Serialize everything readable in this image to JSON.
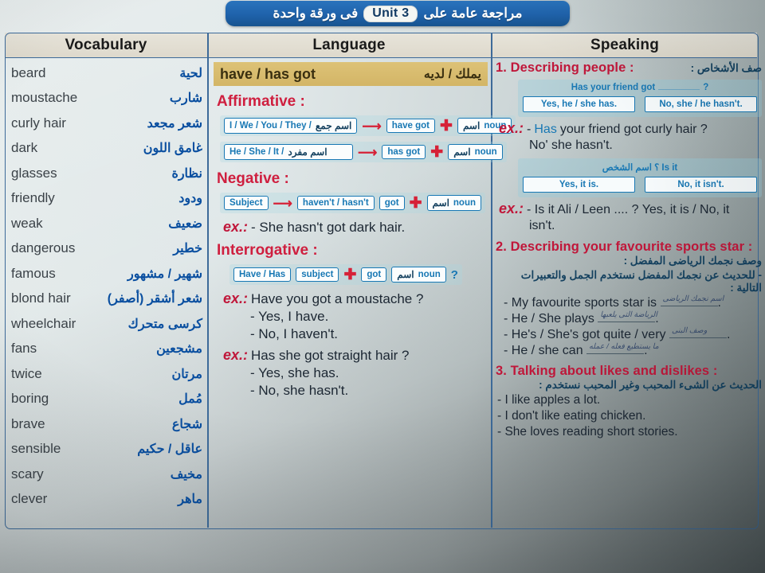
{
  "banner": {
    "text_right": "مراجعة عامة على",
    "unit": "Unit 3",
    "text_left": "فى ورقة واحدة"
  },
  "headers": {
    "vocabulary": "Vocabulary",
    "language": "Language",
    "speaking": "Speaking"
  },
  "vocabulary": [
    {
      "en": "beard",
      "ar": "لحية"
    },
    {
      "en": "moustache",
      "ar": "شارب"
    },
    {
      "en": "curly hair",
      "ar": "شعر مجعد"
    },
    {
      "en": "dark",
      "ar": "غامق اللون"
    },
    {
      "en": "glasses",
      "ar": "نظارة"
    },
    {
      "en": "friendly",
      "ar": "ودود"
    },
    {
      "en": "weak",
      "ar": "ضعيف"
    },
    {
      "en": "dangerous",
      "ar": "خطير"
    },
    {
      "en": "famous",
      "ar": "شهير / مشهور"
    },
    {
      "en": "blond hair",
      "ar": "شعر أشقر (أصفر)"
    },
    {
      "en": "wheelchair",
      "ar": "كرسى متحرك"
    },
    {
      "en": "fans",
      "ar": "مشجعين"
    },
    {
      "en": "twice",
      "ar": "مرتان"
    },
    {
      "en": "boring",
      "ar": "مُمل"
    },
    {
      "en": "brave",
      "ar": "شجاع"
    },
    {
      "en": "sensible",
      "ar": "عاقل / حكيم"
    },
    {
      "en": "scary",
      "ar": "مخيف"
    },
    {
      "en": "clever",
      "ar": "ماهر"
    }
  ],
  "language": {
    "title_en": "have / has got",
    "title_ar": "يملك / لديه",
    "affirmative": {
      "heading": "Affirmative :",
      "row1": {
        "subject_en": "I / We / You / They /",
        "subject_ar": "اسم جمع",
        "verb": "have got",
        "noun_ar": "اسم",
        "noun_en": "noun"
      },
      "row2": {
        "subject_en": "He / She / It /",
        "subject_ar": "اسم مفرد",
        "verb": "has got",
        "noun_ar": "اسم",
        "noun_en": "noun"
      }
    },
    "negative": {
      "heading": "Negative :",
      "subject": "Subject",
      "aux": "haven't / hasn't",
      "got": "got",
      "noun_ar": "اسم",
      "noun_en": "noun",
      "ex_label": "ex.:",
      "ex": "- She hasn't got dark hair."
    },
    "interrogative": {
      "heading": "Interrogative :",
      "aux": "Have / Has",
      "subject": "subject",
      "got": "got",
      "noun_ar": "اسم",
      "noun_en": "noun",
      "question_mark": "?",
      "ex1_label": "ex.:",
      "ex1": "Have you got a moustache ?",
      "ex1_a1": "- Yes, I have.",
      "ex1_a2": "- No, I haven't.",
      "ex2_label": "ex.:",
      "ex2": "Has she got straight hair ?",
      "ex2_a1": "- Yes, she has.",
      "ex2_a2": "- No, she hasn't."
    }
  },
  "speaking": {
    "section1": {
      "number_title": "1. Describing people :",
      "arabic": "صف الأشخاص :",
      "dialogue1": {
        "question_pre": "Has your friend got",
        "question_post": "?",
        "answer_yes": "Yes, he / she has.",
        "answer_no": "No, she / he hasn't."
      },
      "ex_label": "ex.:",
      "ex_dash": "-",
      "ex_highlight": "Has",
      "ex_rest": "your friend got curly hair ?",
      "ex_line2_pre": "No' she ",
      "ex_line2_highlight": "hasn't.",
      "dialogue2": {
        "question_en": "Is it",
        "question_ar": "اسم الشخص",
        "question_post": "؟",
        "answer_yes": "Yes, it is.",
        "answer_no": "No, it isn't."
      },
      "ex2_label": "ex.:",
      "ex2": "- Is it Ali / Leen .... ? Yes, it is / No, it",
      "ex2_line2": "isn't."
    },
    "section2": {
      "number_title": "2. Describing your favourite sports star :",
      "arabic_title": "وصف نجمك الرياضى المفضل :",
      "arabic_note": "- للحديث عن نجمك المفضل نستخدم الجمل والتعبيرات التالية :",
      "bullets": [
        {
          "text": "- My favourite sports star is",
          "hand": "اسم نجمك الرياضى"
        },
        {
          "text": "- He / She plays",
          "hand": "الرياضة التى يلعبها"
        },
        {
          "text": "- He's / She's got quite / very",
          "hand": "وصف البنى"
        },
        {
          "text": "- He / she can",
          "hand": "ما يستطيع فعله / عمله"
        }
      ]
    },
    "section3": {
      "number_title": "3. Talking about likes and dislikes :",
      "arabic": "الحديث عن الشىء المحبب وغير المحبب نستخدم :",
      "lines": [
        "- I like apples a lot.",
        "- I don't like eating chicken.",
        "- She loves reading short stories."
      ]
    }
  },
  "colors": {
    "banner_blue": "#1f62ab",
    "heading_red": "#cf1f3f",
    "box_blue": "#1878b4",
    "arabic_blue": "#0a4fa0",
    "yellow_bar": "#d9bd6e"
  }
}
